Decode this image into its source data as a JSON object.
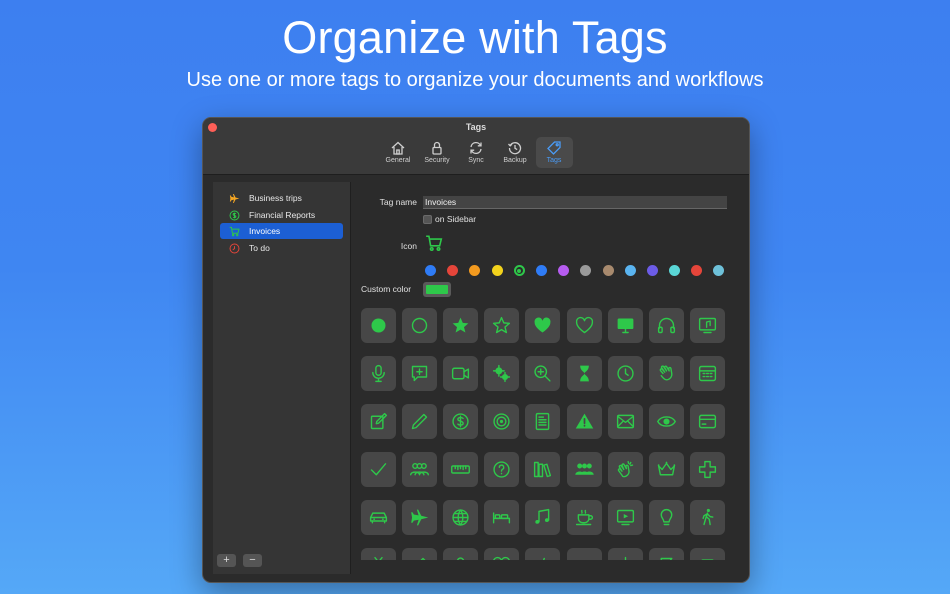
{
  "hero": {
    "title": "Organize with Tags",
    "subtitle": "Use one or more tags to organize your documents and workflows"
  },
  "window": {
    "title": "Tags",
    "toolbar": [
      {
        "label": "General",
        "icon": "house-icon",
        "active": false
      },
      {
        "label": "Security",
        "icon": "lock-icon",
        "active": false
      },
      {
        "label": "Sync",
        "icon": "sync-icon",
        "active": false
      },
      {
        "label": "Backup",
        "icon": "clock-history-icon",
        "active": false
      },
      {
        "label": "Tags",
        "icon": "tag-icon",
        "active": true
      }
    ]
  },
  "sidebar": {
    "items": [
      {
        "label": "Business trips",
        "icon": "airplane-icon",
        "color": "#f5a623",
        "selected": false
      },
      {
        "label": "Financial Reports",
        "icon": "dollar-circle-icon",
        "color": "#2ec84a",
        "selected": false
      },
      {
        "label": "Invoices",
        "icon": "cart-icon",
        "color": "#2ec84a",
        "selected": true
      },
      {
        "label": "To do",
        "icon": "clock-icon",
        "color": "#e5453a",
        "selected": false
      }
    ],
    "add_label": "+",
    "remove_label": "−"
  },
  "form": {
    "tag_name_label": "Tag name",
    "tag_name_value": "Invoices",
    "sidebar_checkbox_label": "on Sidebar",
    "icon_label": "Icon",
    "custom_color_label": "Custom color",
    "accent_color": "#2ec84a",
    "swatches": [
      "#2f7cf6",
      "#e5453a",
      "#f39a1f",
      "#f2d21c",
      "#2ec84a",
      "#2f7cf6",
      "#b65cf0",
      "#9a9a9a",
      "#a88a6e",
      "#5ab4f0",
      "#6c5ce7",
      "#5ad6d6",
      "#e5453a",
      "#6ec1d9"
    ],
    "selected_swatch": 4
  },
  "icon_grid": [
    [
      "circle-filled-icon",
      "circle-outline-icon",
      "star-filled-icon",
      "star-outline-icon",
      "heart-filled-icon",
      "heart-outline-icon",
      "monitor-icon",
      "headphones-icon",
      "music-display-icon"
    ],
    [
      "microphone-icon",
      "chat-plus-icon",
      "video-camera-icon",
      "gears-icon",
      "zoom-in-icon",
      "hourglass-icon",
      "clock-icon",
      "hand-wave-icon",
      "calendar-icon"
    ],
    [
      "edit-icon",
      "pencil-icon",
      "dollar-circle-icon",
      "target-icon",
      "document-icon",
      "warning-icon",
      "envelope-icon",
      "eye-icon",
      "credit-card-icon"
    ],
    [
      "checkmark-icon",
      "people-outline-icon",
      "ruler-icon",
      "question-circle-icon",
      "books-icon",
      "people-filled-icon",
      "clapping-hands-icon",
      "crown-icon",
      "cross-icon"
    ],
    [
      "car-icon",
      "airplane-icon",
      "globe-icon",
      "bed-icon",
      "music-notes-icon",
      "coffee-cup-icon",
      "play-screen-icon",
      "lightbulb-icon",
      "walking-icon"
    ],
    [
      "tv-icon",
      "pen-icon",
      "person-icon",
      "heart-outline-icon",
      "tools-icon",
      "folder-icon",
      "sparkle-icon",
      "flag-icon",
      "square-icon"
    ]
  ]
}
